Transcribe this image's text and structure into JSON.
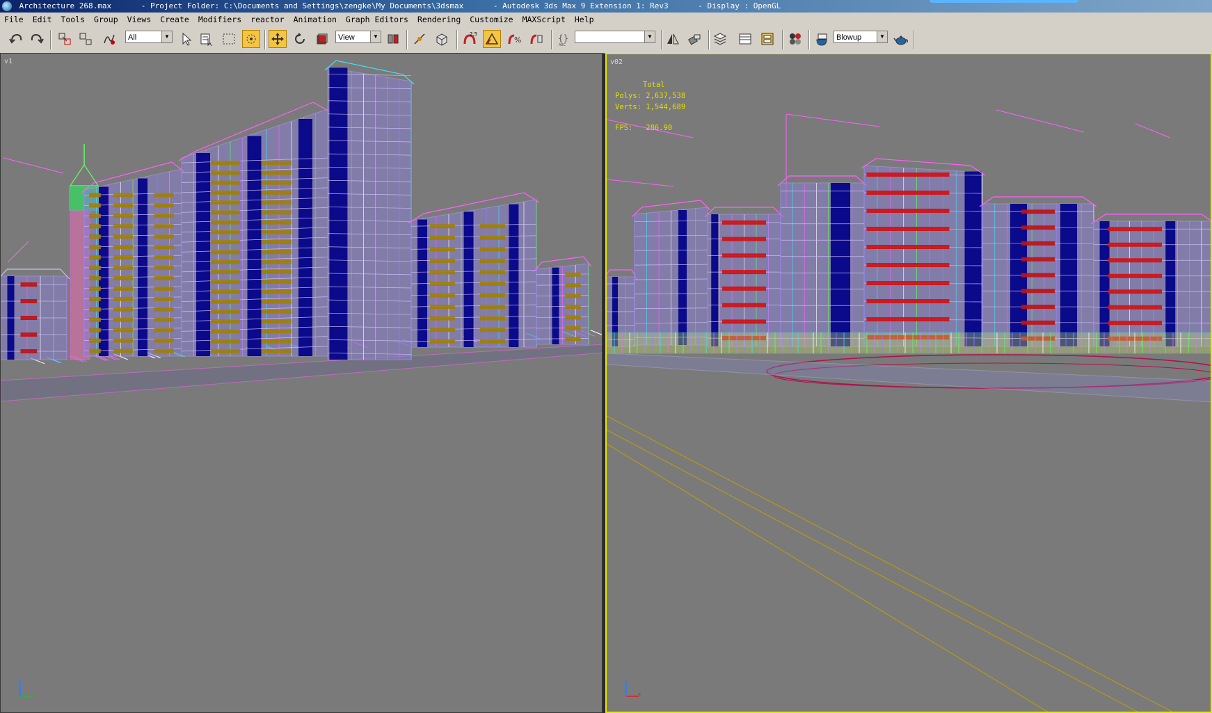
{
  "window": {
    "file": "Architecture 268.max",
    "project": "- Project Folder: C:\\Documents and Settings\\zengke\\My Documents\\3dsmax",
    "app": "- Autodesk 3ds Max 9 Extension 1: Rev3",
    "display": "- Display : OpenGL"
  },
  "menu": [
    "File",
    "Edit",
    "Tools",
    "Group",
    "Views",
    "Create",
    "Modifiers",
    "reactor",
    "Animation",
    "Graph Editors",
    "Rendering",
    "Customize",
    "MAXScript",
    "Help"
  ],
  "toolbar": {
    "selection_filter": "All",
    "reference_coord": "View",
    "named_selection": "",
    "render_preset": "Blowup",
    "angle_snap": "2.5"
  },
  "viewport_left": {
    "label": "v1"
  },
  "viewport_right": {
    "label": "v02",
    "stats_total": "Total",
    "stats_polys": "Polys: 2,637,538",
    "stats_verts": "Verts: 1,544,689",
    "stats_fps": "FPS:   286.90"
  },
  "axes": {
    "z": "z",
    "x": "x"
  },
  "colors": {
    "accent": "#e6e600",
    "viewport_bg": "#7a7a7a",
    "stats": "#e0e000"
  }
}
